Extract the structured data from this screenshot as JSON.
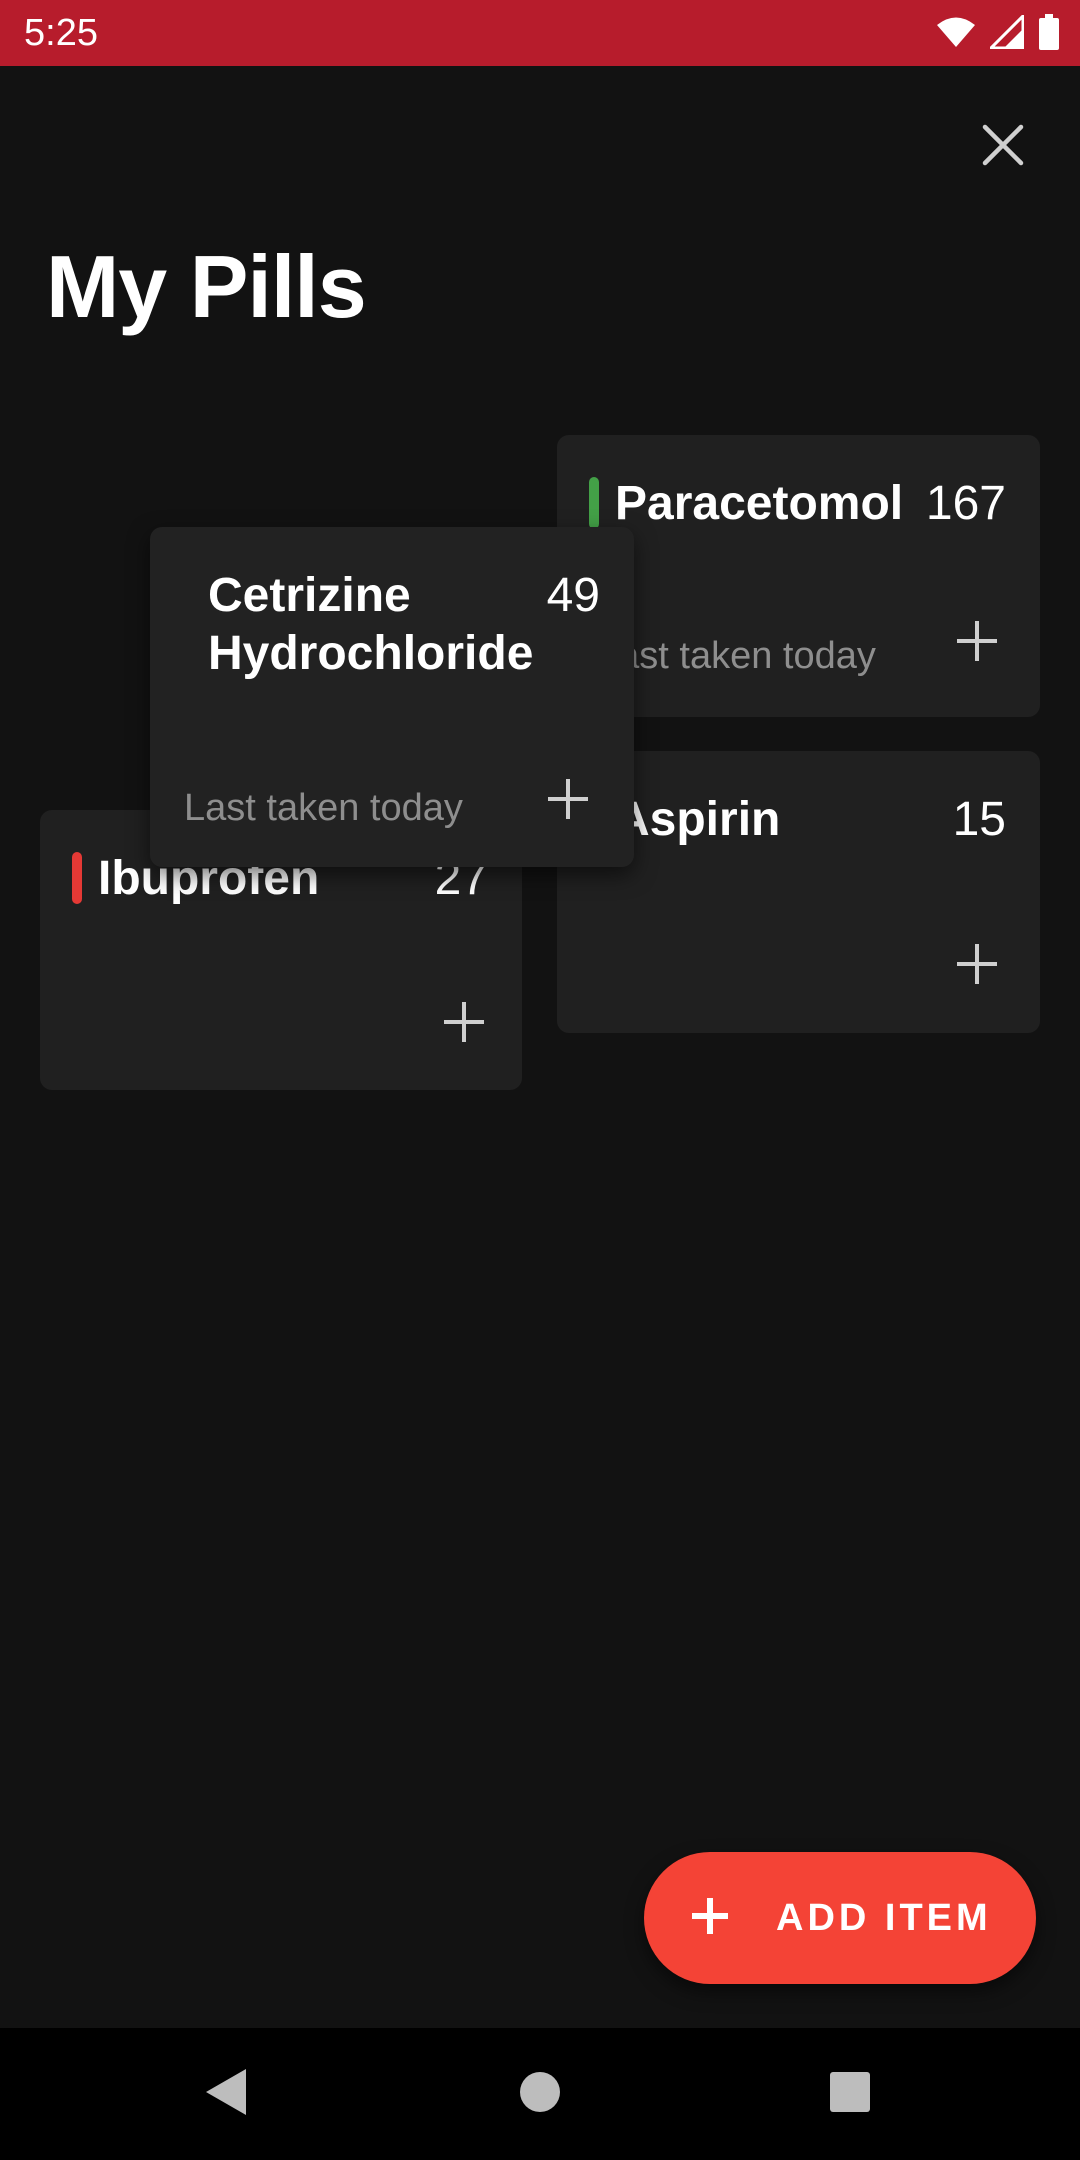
{
  "status_bar": {
    "time": "5:25",
    "icons": [
      "wifi-icon",
      "signal-icon",
      "battery-icon"
    ],
    "background": "#b71c2c"
  },
  "header": {
    "title": "My Pills",
    "close_icon": "close-icon"
  },
  "pills": [
    {
      "name": "Paracetomol",
      "count": "167",
      "last_taken": "Last taken today",
      "accent": "#43a047"
    },
    {
      "name": "Aspirin",
      "count": "15",
      "last_taken": "",
      "accent": ""
    },
    {
      "name": "Ibuprofen",
      "count": "27",
      "last_taken": "",
      "accent": "#e53935"
    },
    {
      "name": "Cetrizine Hydrochloride",
      "count": "49",
      "last_taken": "Last taken today",
      "accent": ""
    }
  ],
  "fab": {
    "label": "ADD ITEM",
    "icon": "plus-icon",
    "color": "#f44336"
  },
  "nav": {
    "back": "back-icon",
    "home": "home-icon",
    "recents": "recents-icon"
  }
}
